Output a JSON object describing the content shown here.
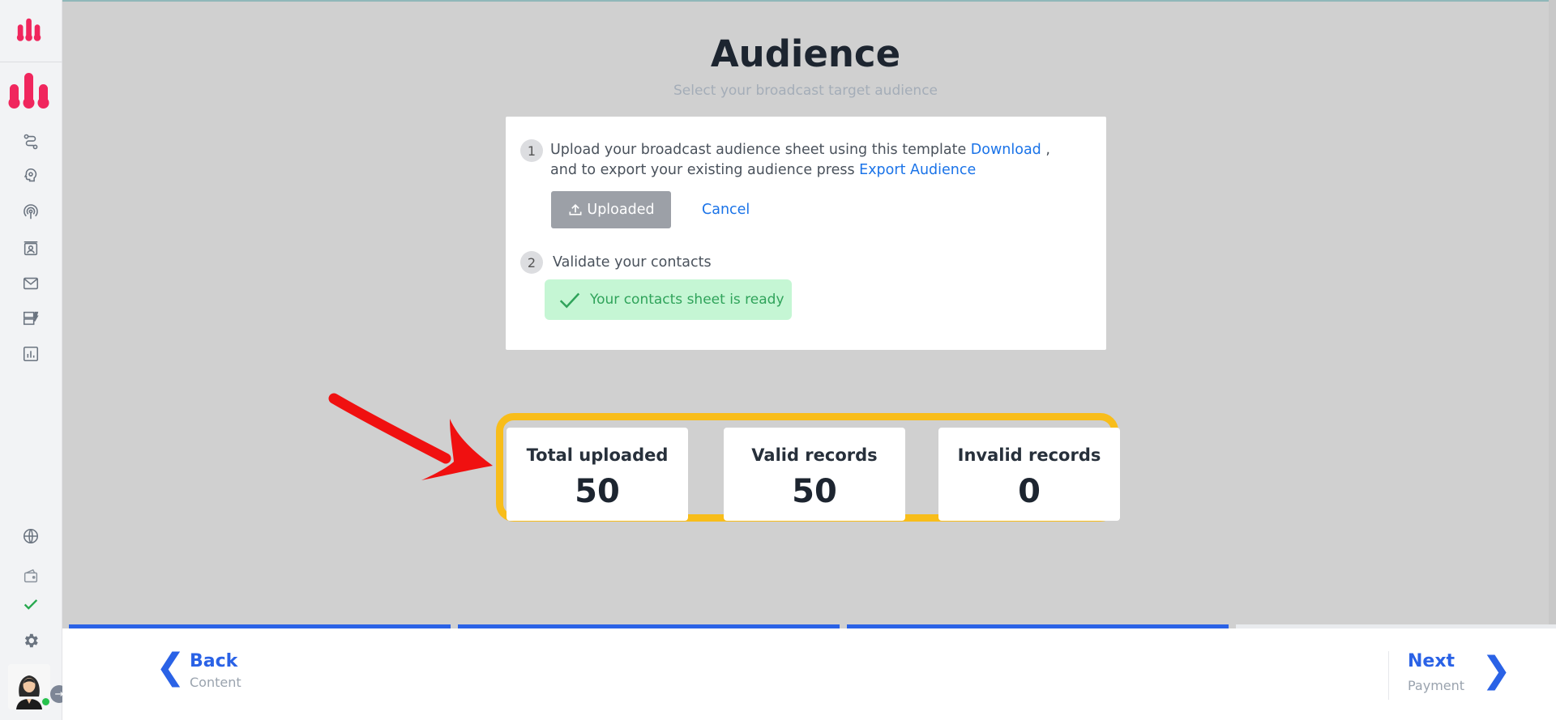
{
  "sidebar": {
    "icons": [
      {
        "name": "flows-icon"
      },
      {
        "name": "bot-icon"
      },
      {
        "name": "broadcast-icon"
      },
      {
        "name": "contacts-icon"
      },
      {
        "name": "inbox-icon"
      },
      {
        "name": "templates-icon"
      },
      {
        "name": "analytics-icon"
      }
    ],
    "bottom_icons": [
      {
        "name": "globe-icon"
      },
      {
        "name": "wallet-icon"
      },
      {
        "name": "check-icon"
      },
      {
        "name": "gear-icon"
      }
    ],
    "expand_glyph": "→"
  },
  "header": {
    "title": "Audience",
    "subtitle": "Select your broadcast target audience"
  },
  "upload_card": {
    "step1_number": "1",
    "step1_text_a": "Upload your broadcast audience sheet using this template ",
    "step1_download_link": "Download",
    "step1_text_b": " ,",
    "step1_text_c": "and to export your existing audience press ",
    "step1_export_link": "Export Audience",
    "uploaded_button": "Uploaded",
    "cancel_button": "Cancel",
    "step2_number": "2",
    "step2_text": "Validate your contacts",
    "ready_text": "Your contacts sheet is ready"
  },
  "stats": [
    {
      "label": "Total uploaded",
      "value": "50"
    },
    {
      "label": "Valid records",
      "value": "50"
    },
    {
      "label": "Invalid records",
      "value": "0"
    }
  ],
  "progress": {
    "steps_completed": 3,
    "steps_total": 4
  },
  "footer": {
    "back_label": "Back",
    "back_sub": "Content",
    "next_label": "Next",
    "next_sub": "Payment",
    "back_chevron": "❮",
    "next_chevron": "❯"
  },
  "colors": {
    "brand": "#f0265d",
    "accent": "#2a62e6",
    "highlight": "#f8bd1a",
    "annotation_arrow": "#f01010",
    "success": "#2fa35a"
  }
}
